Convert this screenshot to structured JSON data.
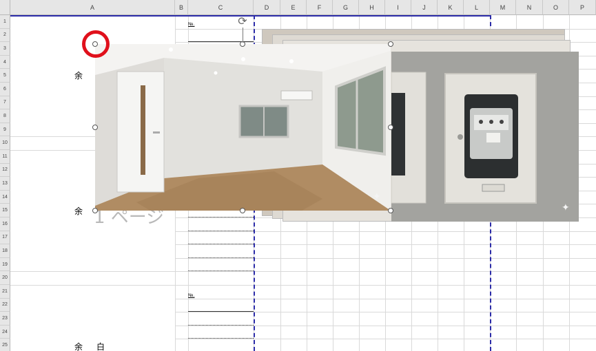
{
  "columns": [
    "A",
    "B",
    "C",
    "D",
    "E",
    "F",
    "G",
    "H",
    "I",
    "J",
    "K",
    "L",
    "M",
    "N",
    "O",
    "P"
  ],
  "rows": [
    "1",
    "2",
    "3",
    "4",
    "5",
    "6",
    "7",
    "8",
    "9",
    "10",
    "11",
    "12",
    "13",
    "14",
    "15",
    "16",
    "17",
    "18",
    "19",
    "20",
    "21",
    "22",
    "23",
    "24",
    "25"
  ],
  "cells": {
    "no_label_1": "№.",
    "no_label_2": "№.",
    "margin_text_1": "余",
    "margin_text_2": "余",
    "margin_text_3": "余　白",
    "watermark_page": "1 ページ"
  },
  "images": {
    "room_photo": "empty-room-interior-photo",
    "meter_photo": "gas-meter-box-photo"
  },
  "icons": {
    "rotate": "rotate-handle-icon",
    "sparkle": "sparkle-icon"
  },
  "colors": {
    "page_break": "#2b2ba8",
    "highlight": "#e0101b",
    "grid": "#d9d9d9"
  }
}
